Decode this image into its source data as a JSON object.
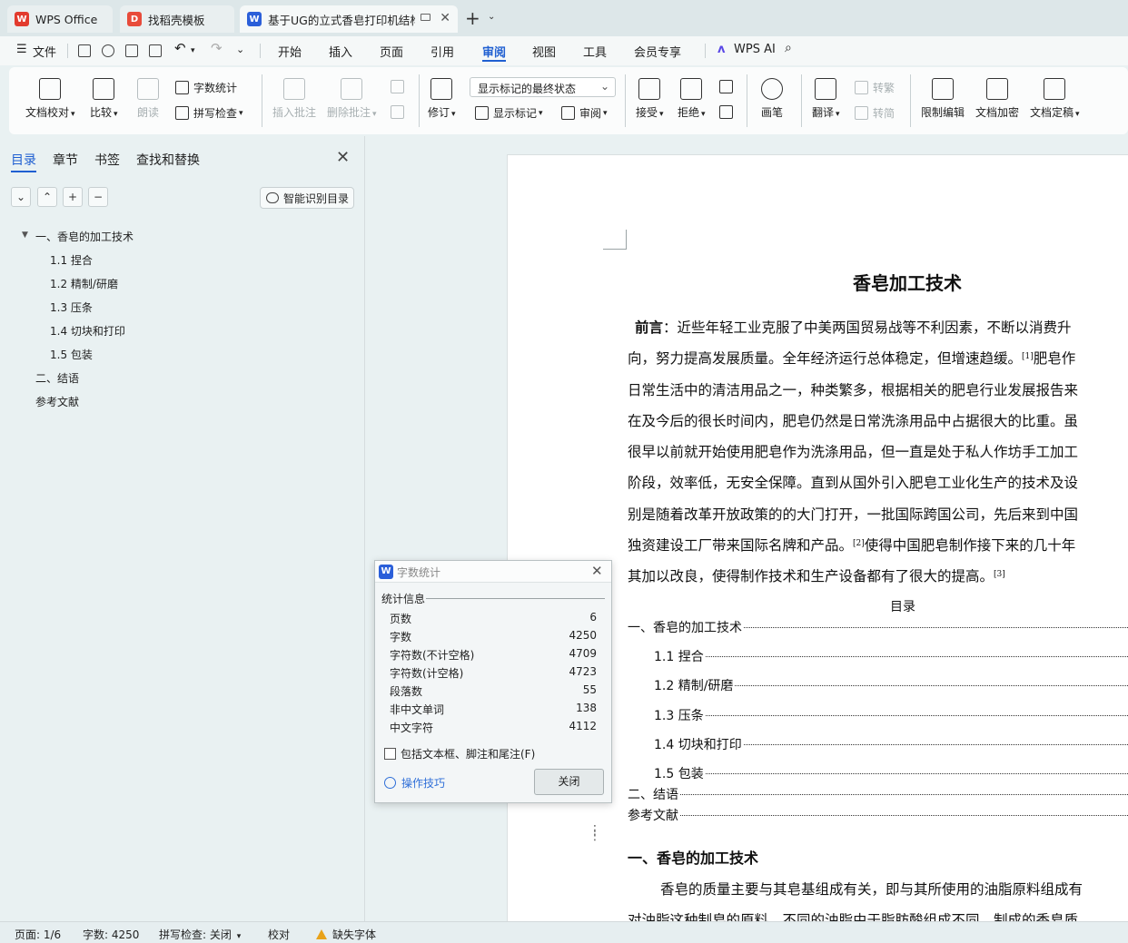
{
  "tabs": [
    {
      "label": "WPS Office",
      "icon": "wps-logo-icon"
    },
    {
      "label": "找稻壳模板",
      "icon": "docer-icon"
    },
    {
      "label": "基于UG的立式香皂打印机结构",
      "icon": "word-doc-icon"
    }
  ],
  "menu": {
    "file": "文件",
    "items": [
      "开始",
      "插入",
      "页面",
      "引用",
      "审阅",
      "视图",
      "工具",
      "会员专享"
    ],
    "active": "审阅",
    "wps_ai": "WPS AI"
  },
  "ribbon": {
    "doc_check": "文档校对",
    "compare": "比较",
    "read_aloud": "朗读",
    "word_count": "字数统计",
    "spell_check": "拼写检查",
    "insert_comment": "插入批注",
    "delete_comment": "删除批注",
    "revise": "修订",
    "markup_state": "显示标记的最终状态",
    "show_markup": "显示标记",
    "review": "审阅",
    "accept": "接受",
    "reject": "拒绝",
    "pen": "画笔",
    "translate": "翻译",
    "to_traditional": "转繁",
    "to_simplified": "转简",
    "restrict_edit": "限制编辑",
    "encrypt": "文档加密",
    "finalize": "文档定稿"
  },
  "nav": {
    "tabs": [
      "目录",
      "章节",
      "书签",
      "查找和替换"
    ],
    "smart_toc": "智能识别目录",
    "toc": [
      "一、香皂的加工技术",
      "1.1 捏合",
      "1.2 精制/研磨",
      "1.3 压条",
      "1.4 切块和打印",
      "1.5 包装",
      "二、结语",
      "参考文献"
    ]
  },
  "doc": {
    "title": "香皂加工技术",
    "preface_label": "前言",
    "lines": [
      "：近些年轻工业克服了中美两国贸易战等不利因素，不断以消费升",
      "向，努力提高发展质量。全年经济运行总体稳定，但增速趋缓。",
      "日常生活中的清洁用品之一，种类繁多，根据相关的肥皂行业发展报告来",
      "在及今后的很长时间内，肥皂仍然是日常洗涤用品中占据很大的比重。虽",
      "很早以前就开始使用肥皂作为洗涤用品，但一直是处于私人作坊手工加工",
      "阶段，效率低，无安全保障。直到从国外引入肥皂工业化生产的技术及设",
      "别是随着改革开放政策的的大门打开，一批国际跨国公司，先后来到中国",
      "独资建设工厂带来国际名牌和产品。",
      "其加以改良，使得制作技术和生产设备都有了很大的提高。"
    ],
    "line2_tail": "肥皂作",
    "line8_tail": "使得中国肥皂制作接下来的几十年",
    "refs": [
      "[1]",
      "[2]",
      "[3]"
    ],
    "toc_heading": "目录",
    "toc": [
      "一、香皂的加工技术",
      "1.1 捏合",
      "1.2 精制/研磨",
      "1.3 压条",
      "1.4 切块和打印",
      "1.5 包装",
      "二、结语",
      "参考文献"
    ],
    "section1": "一、香皂的加工技术",
    "section1_p1": "香皂的质量主要与其皂基组成有关，即与其所使用的油脂原料组成有",
    "section1_p2": "对油脂这种制皂的原料。不同的油脂由于脂肪酸组成不同，制成的香皂质"
  },
  "dialog": {
    "title": "字数统计",
    "section": "统计信息",
    "stats": [
      {
        "label": "页数",
        "value": "6"
      },
      {
        "label": "字数",
        "value": "4250"
      },
      {
        "label": "字符数(不计空格)",
        "value": "4709"
      },
      {
        "label": "字符数(计空格)",
        "value": "4723"
      },
      {
        "label": "段落数",
        "value": "55"
      },
      {
        "label": "非中文单词",
        "value": "138"
      },
      {
        "label": "中文字符",
        "value": "4112"
      }
    ],
    "include_label": "包括文本框、脚注和尾注(F)",
    "tips": "操作技巧",
    "close": "关闭"
  },
  "status": {
    "page": "页面: 1/6",
    "words": "字数: 4250",
    "spell": "拼写检查: 关闭",
    "proof": "校对",
    "missing_font": "缺失字体"
  },
  "colors": {
    "accent": "#1f5fd1",
    "wps_red": "#e23b2e",
    "word_blue": "#2b5fd9"
  }
}
